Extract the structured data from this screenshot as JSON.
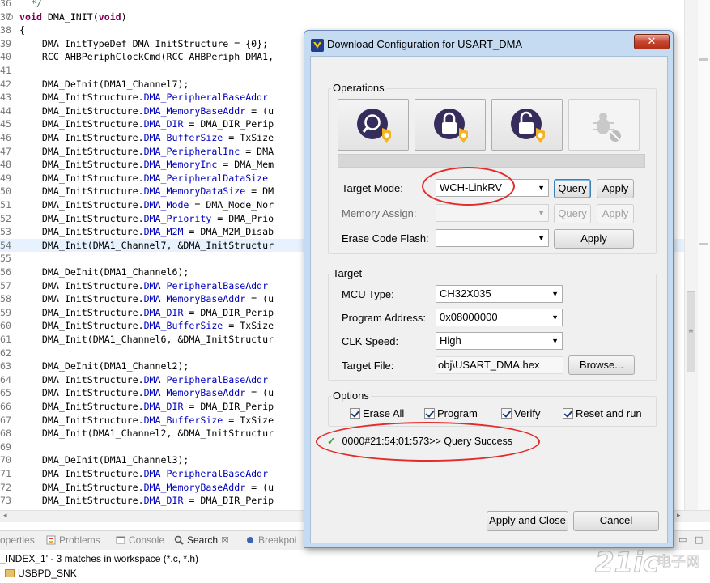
{
  "editor": {
    "lines": [
      {
        "num": "36",
        "segments": [
          {
            "t": "  */",
            "c": "cmt"
          }
        ]
      },
      {
        "num": "37",
        "fold": true,
        "segments": [
          {
            "t": "void",
            "c": "kw"
          },
          {
            "t": " DMA_INIT("
          },
          {
            "t": "void",
            "c": "kw"
          },
          {
            "t": ")"
          }
        ]
      },
      {
        "num": "38",
        "segments": [
          {
            "t": "{"
          }
        ]
      },
      {
        "num": "39",
        "segments": [
          {
            "t": "    DMA_InitTypeDef DMA_InitStructure = {0};"
          }
        ]
      },
      {
        "num": "40",
        "segments": [
          {
            "t": "    RCC_AHBPeriphClockCmd(RCC_AHBPeriph_DMA1,"
          }
        ]
      },
      {
        "num": "41",
        "segments": [
          {
            "t": ""
          }
        ]
      },
      {
        "num": "42",
        "segments": [
          {
            "t": "    DMA_DeInit(DMA1_Channel7);"
          }
        ]
      },
      {
        "num": "43",
        "segments": [
          {
            "t": "    DMA_InitStructure."
          },
          {
            "t": "DMA_PeripheralBaseAddr",
            "c": "fld"
          }
        ]
      },
      {
        "num": "44",
        "segments": [
          {
            "t": "    DMA_InitStructure."
          },
          {
            "t": "DMA_MemoryBaseAddr",
            "c": "fld"
          },
          {
            "t": " = (u"
          }
        ]
      },
      {
        "num": "45",
        "segments": [
          {
            "t": "    DMA_InitStructure."
          },
          {
            "t": "DMA_DIR",
            "c": "fld"
          },
          {
            "t": " = DMA_DIR_Perip"
          }
        ]
      },
      {
        "num": "46",
        "segments": [
          {
            "t": "    DMA_InitStructure."
          },
          {
            "t": "DMA_BufferSize",
            "c": "fld"
          },
          {
            "t": " = TxSize"
          }
        ]
      },
      {
        "num": "47",
        "segments": [
          {
            "t": "    DMA_InitStructure."
          },
          {
            "t": "DMA_PeripheralInc",
            "c": "fld"
          },
          {
            "t": " = DMA"
          }
        ]
      },
      {
        "num": "48",
        "segments": [
          {
            "t": "    DMA_InitStructure."
          },
          {
            "t": "DMA_MemoryInc",
            "c": "fld"
          },
          {
            "t": " = DMA_Mem"
          }
        ]
      },
      {
        "num": "49",
        "segments": [
          {
            "t": "    DMA_InitStructure."
          },
          {
            "t": "DMA_PeripheralDataSize",
            "c": "fld"
          }
        ]
      },
      {
        "num": "50",
        "segments": [
          {
            "t": "    DMA_InitStructure."
          },
          {
            "t": "DMA_MemoryDataSize",
            "c": "fld"
          },
          {
            "t": " = DM"
          }
        ]
      },
      {
        "num": "51",
        "segments": [
          {
            "t": "    DMA_InitStructure."
          },
          {
            "t": "DMA_Mode",
            "c": "fld"
          },
          {
            "t": " = DMA_Mode_Nor"
          }
        ]
      },
      {
        "num": "52",
        "segments": [
          {
            "t": "    DMA_InitStructure."
          },
          {
            "t": "DMA_Priority",
            "c": "fld"
          },
          {
            "t": " = DMA_Prio"
          }
        ]
      },
      {
        "num": "53",
        "segments": [
          {
            "t": "    DMA_InitStructure."
          },
          {
            "t": "DMA_M2M",
            "c": "fld"
          },
          {
            "t": " = DMA_M2M_Disab"
          }
        ]
      },
      {
        "num": "54",
        "hl": true,
        "segments": [
          {
            "t": "    DMA_Init(DMA1_Channel7, &DMA_InitStructur"
          }
        ]
      },
      {
        "num": "55",
        "segments": [
          {
            "t": ""
          }
        ]
      },
      {
        "num": "56",
        "segments": [
          {
            "t": "    DMA_DeInit(DMA1_Channel6);"
          }
        ]
      },
      {
        "num": "57",
        "segments": [
          {
            "t": "    DMA_InitStructure."
          },
          {
            "t": "DMA_PeripheralBaseAddr",
            "c": "fld"
          }
        ]
      },
      {
        "num": "58",
        "segments": [
          {
            "t": "    DMA_InitStructure."
          },
          {
            "t": "DMA_MemoryBaseAddr",
            "c": "fld"
          },
          {
            "t": " = (u"
          }
        ]
      },
      {
        "num": "59",
        "segments": [
          {
            "t": "    DMA_InitStructure."
          },
          {
            "t": "DMA_DIR",
            "c": "fld"
          },
          {
            "t": " = DMA_DIR_Perip"
          }
        ]
      },
      {
        "num": "60",
        "segments": [
          {
            "t": "    DMA_InitStructure."
          },
          {
            "t": "DMA_BufferSize",
            "c": "fld"
          },
          {
            "t": " = TxSize"
          }
        ]
      },
      {
        "num": "61",
        "segments": [
          {
            "t": "    DMA_Init(DMA1_Channel6, &DMA_InitStructur"
          }
        ]
      },
      {
        "num": "62",
        "segments": [
          {
            "t": ""
          }
        ]
      },
      {
        "num": "63",
        "segments": [
          {
            "t": "    DMA_DeInit(DMA1_Channel2);"
          }
        ]
      },
      {
        "num": "64",
        "segments": [
          {
            "t": "    DMA_InitStructure."
          },
          {
            "t": "DMA_PeripheralBaseAddr",
            "c": "fld"
          }
        ]
      },
      {
        "num": "65",
        "segments": [
          {
            "t": "    DMA_InitStructure."
          },
          {
            "t": "DMA_MemoryBaseAddr",
            "c": "fld"
          },
          {
            "t": " = (u"
          }
        ]
      },
      {
        "num": "66",
        "segments": [
          {
            "t": "    DMA_InitStructure."
          },
          {
            "t": "DMA_DIR",
            "c": "fld"
          },
          {
            "t": " = DMA_DIR_Perip"
          }
        ]
      },
      {
        "num": "67",
        "segments": [
          {
            "t": "    DMA_InitStructure."
          },
          {
            "t": "DMA_BufferSize",
            "c": "fld"
          },
          {
            "t": " = TxSize"
          }
        ]
      },
      {
        "num": "68",
        "segments": [
          {
            "t": "    DMA_Init(DMA1_Channel2, &DMA_InitStructur"
          }
        ]
      },
      {
        "num": "69",
        "segments": [
          {
            "t": ""
          }
        ]
      },
      {
        "num": "70",
        "segments": [
          {
            "t": "    DMA_DeInit(DMA1_Channel3);"
          }
        ]
      },
      {
        "num": "71",
        "segments": [
          {
            "t": "    DMA_InitStructure."
          },
          {
            "t": "DMA_PeripheralBaseAddr",
            "c": "fld"
          }
        ]
      },
      {
        "num": "72",
        "segments": [
          {
            "t": "    DMA_InitStructure."
          },
          {
            "t": "DMA_MemoryBaseAddr",
            "c": "fld"
          },
          {
            "t": " = (u"
          }
        ]
      },
      {
        "num": "73",
        "segments": [
          {
            "t": "    DMA_InitStructure."
          },
          {
            "t": "DMA_DIR",
            "c": "fld"
          },
          {
            "t": " = DMA_DIR_Perip"
          }
        ]
      }
    ]
  },
  "panel": {
    "tabs": [
      {
        "label": "operties",
        "icon": "properties-icon"
      },
      {
        "label": "Problems",
        "icon": "problems-icon"
      },
      {
        "label": "Console",
        "icon": "console-icon"
      },
      {
        "label": "Search",
        "icon": "search-icon",
        "active": true,
        "close": "☒"
      },
      {
        "label": "Breakpoi",
        "icon": "breakpoints-icon"
      }
    ],
    "search_summary": "_INDEX_1' - 3 matches in workspace (*.c, *.h)",
    "result_project": "USBPD_SNK"
  },
  "dialog": {
    "title": "Download Configuration for USART_DMA",
    "close_glyph": "✕",
    "operations_label": "Operations",
    "target_mode_label": "Target Mode:",
    "target_mode_value": "WCH-LinkRV",
    "query_label": "Query",
    "apply_label": "Apply",
    "memory_assign_label": "Memory Assign:",
    "memory_assign_value": "",
    "erase_code_flash_label": "Erase Code Flash:",
    "erase_code_flash_value": "",
    "target_label": "Target",
    "mcu_type_label": "MCU Type:",
    "mcu_type_value": "CH32X035",
    "program_address_label": "Program Address:",
    "program_address_value": "0x08000000",
    "clk_speed_label": "CLK Speed:",
    "clk_speed_value": "High",
    "target_file_label": "Target File:",
    "target_file_value": "obj\\USART_DMA.hex",
    "browse_label": "Browse...",
    "options_label": "Options",
    "erase_all_label": "Erase All",
    "program_label": "Program",
    "verify_label": "Verify",
    "reset_and_run_label": "Reset and run",
    "log_glyph": "✓",
    "log_text": "0000#21:54:01:573>> Query Success",
    "apply_and_close_label": "Apply and Close",
    "cancel_label": "Cancel",
    "combo_arrow": "▼"
  },
  "watermark": {
    "brand": "21ic",
    "suffix": "电子网"
  },
  "colors": {
    "annotation_ring": "#e32b2b",
    "dialog_frame": "#c4dbf1",
    "keyword": "#7f0055",
    "field": "#0000c0"
  }
}
